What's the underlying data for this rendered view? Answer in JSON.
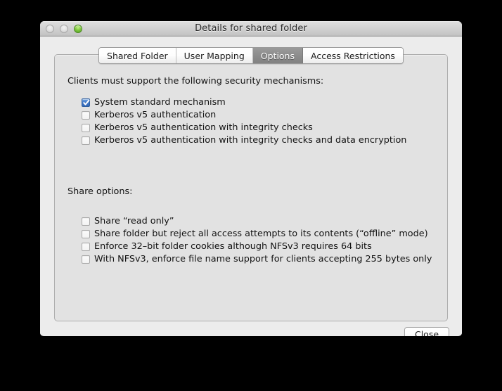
{
  "window": {
    "title": "Details for shared folder",
    "controls": {
      "close": "close-button",
      "minimize": "minimize-button",
      "zoom": "zoom-button"
    }
  },
  "tabs": [
    {
      "label": "Shared Folder",
      "selected": false
    },
    {
      "label": "User Mapping",
      "selected": false
    },
    {
      "label": "Options",
      "selected": true
    },
    {
      "label": "Access Restrictions",
      "selected": false
    }
  ],
  "security": {
    "heading": "Clients must support the following security mechanisms:",
    "options": [
      {
        "label": "System standard mechanism",
        "checked": true
      },
      {
        "label": "Kerberos v5 authentication",
        "checked": false
      },
      {
        "label": "Kerberos v5 authentication with integrity checks",
        "checked": false
      },
      {
        "label": "Kerberos v5 authentication with integrity checks and data encryption",
        "checked": false
      }
    ]
  },
  "share": {
    "heading": "Share options:",
    "options": [
      {
        "label": "Share “read only”",
        "checked": false
      },
      {
        "label": "Share folder but reject all access attempts to its contents (“offline” mode)",
        "checked": false
      },
      {
        "label": "Enforce 32–bit folder cookies although NFSv3 requires 64 bits",
        "checked": false
      },
      {
        "label": "With NFSv3, enforce file name support for clients accepting 255 bytes only",
        "checked": false
      }
    ]
  },
  "footer": {
    "close_label": "Close"
  },
  "colors": {
    "accent_checkbox": "#3f76c6",
    "selected_tab": "#8d8d8d",
    "panel_bg": "#e2e2e2",
    "window_bg": "#ececec",
    "zoom_light": "#7fc93f"
  }
}
